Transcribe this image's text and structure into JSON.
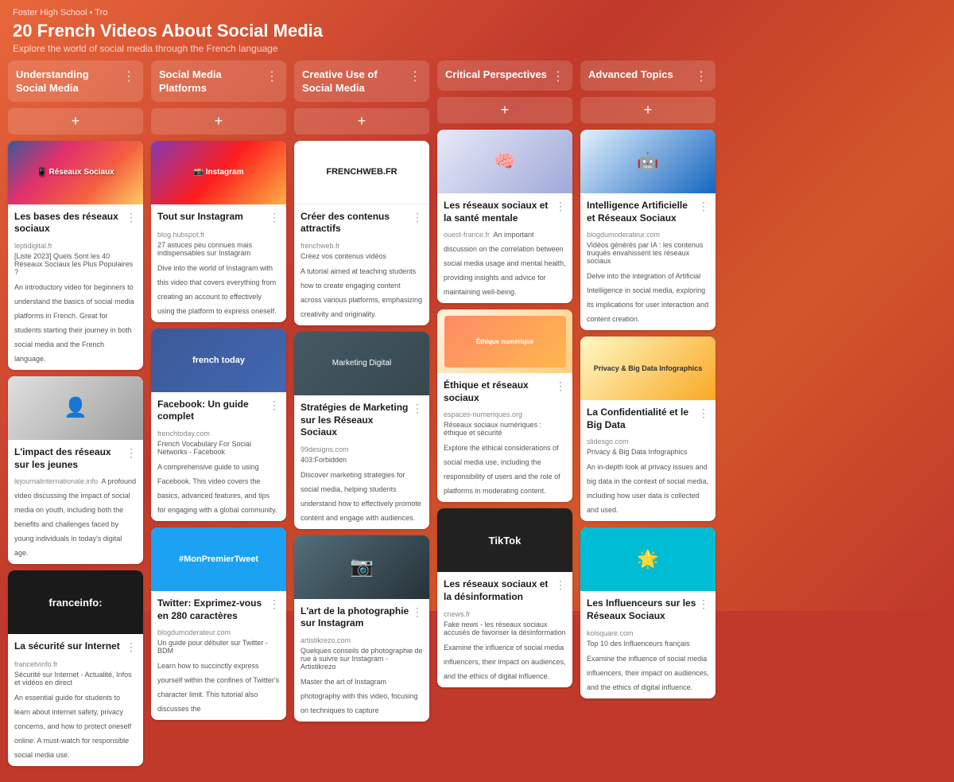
{
  "header": {
    "breadcrumb": "Foster High School • Tro",
    "title": "20 French Videos About Social Media",
    "subtitle": "Explore the world of social media through the French language"
  },
  "columns": [
    {
      "id": "col1",
      "title": "Understanding Social Media",
      "cards": [
        {
          "id": "c1",
          "title": "Les bases des réseaux sociaux",
          "source_domain": "leptidigital.fr",
          "source_link": "[Liste 2023] Quels Sont les 40 Réseaux Sociaux les Plus Populaires ?",
          "desc": "An introductory video for beginners to understand the basics of social media platforms in French. Great for students starting their journey in both social media and the French language.",
          "img_class": "img-social-platforms",
          "img_text": ""
        },
        {
          "id": "c2",
          "title": "L'impact des réseaux sur les jeunes",
          "source_domain": "lejournalinternationale.info",
          "source_link": "",
          "desc": "A profound video discussing the impact of social media on youth, including both the benefits and challenges faced by young individuals in today's digital age.",
          "img_class": "img-youth",
          "img_text": ""
        },
        {
          "id": "c3",
          "title": "La sécurité sur Internet",
          "source_domain": "francetvinfo.fr",
          "source_link": "Sécurité sur Internet - Actualité, Infos et vidéos en direct",
          "desc": "An essential guide for students to learn about internet safety, privacy concerns, and how to protect oneself online. A must-watch for responsible social media use.",
          "img_class": "img-internet-safety",
          "img_text": "franceinfo:"
        }
      ]
    },
    {
      "id": "col2",
      "title": "Social Media Platforms",
      "cards": [
        {
          "id": "c4",
          "title": "Tout sur Instagram",
          "source_domain": "blog.hubspot.fr",
          "source_link": "27 astuces peu connues mais indispensables sur Instagram",
          "desc": "Dive into the world of Instagram with this video that covers everything from creating an account to effectively using the platform to express oneself.",
          "img_class": "img-instagram",
          "img_text": ""
        },
        {
          "id": "c5",
          "title": "Facebook: Un guide complet",
          "source_domain": "frenchtoday.com",
          "source_link": "French Vocabulary For Social Networks - Facebook",
          "desc": "A comprehensive guide to using Facebook. This video covers the basics, advanced features, and tips for engaging with a global community.",
          "img_class": "img-facebook",
          "img_text": "french today"
        },
        {
          "id": "c6",
          "title": "Twitter: Exprimez-vous en 280 caractères",
          "source_domain": "blogdumoderateur.com",
          "source_link": "Un guide pour débuter sur Twitter - BDM",
          "desc": "Learn how to succinctly express yourself within the confines of Twitter's character limit. This tutorial also discusses the",
          "img_class": "img-twitter",
          "img_text": "#MonPremierTweet"
        }
      ]
    },
    {
      "id": "col3",
      "title": "Creative Use of Social Media",
      "cards": [
        {
          "id": "c7",
          "title": "Créer des contenus attractifs",
          "source_domain": "frenchweb.fr",
          "source_link": "Créez vos contenus vidéos",
          "desc": "A tutorial aimed at teaching students how to create engaging content across various platforms, emphasizing creativity and originality.",
          "img_class": "img-creative",
          "img_text": "FRENCHWEB.FR"
        },
        {
          "id": "c8",
          "title": "Stratégies de Marketing sur les Réseaux Sociaux",
          "source_domain": "99designs.com",
          "source_link": "403:Forbidden",
          "desc": "Discover marketing strategies for social media, helping students understand how to effectively promote content and engage with audiences.",
          "img_class": "img-marketing",
          "img_text": ""
        },
        {
          "id": "c9",
          "title": "L'art de la photographie sur Instagram",
          "source_domain": "artistikrezo.com",
          "source_link": "Quelques conseils de photographie de rue à suivre sur Instagram - Artistikrezo",
          "desc": "Master the art of Instagram photography with this video, focusing on techniques to capture",
          "img_class": "img-photography",
          "img_text": ""
        }
      ]
    },
    {
      "id": "col4",
      "title": "Critical Perspectives",
      "cards": [
        {
          "id": "c10",
          "title": "Les réseaux sociaux et la santé mentale",
          "source_domain": "ouest-france.fr",
          "source_link": "",
          "desc": "An important discussion on the correlation between social media usage and mental health, providing insights and advice for maintaining well-being.",
          "img_class": "img-mental-health",
          "img_text": ""
        },
        {
          "id": "c11",
          "title": "Éthique et réseaux sociaux",
          "source_domain": "espaces-numeriques.org",
          "source_link": "Réseaux sociaux numériques : éthique et sécurité",
          "desc": "Explore the ethical considerations of social media use, including the responsibility of users and the role of platforms in moderating content.",
          "img_class": "img-ethics",
          "img_text": ""
        },
        {
          "id": "c12",
          "title": "Les réseaux sociaux et la désinformation",
          "source_domain": "cnews.fr",
          "source_link": "Fake news - les réseaux sociaux accusés de favoriser la désinformation",
          "desc": "Examine the influence of social media influencers, their impact on audiences, and the ethics of digital influence.",
          "img_class": "img-disinformation",
          "img_text": "TikTok"
        }
      ]
    },
    {
      "id": "col5",
      "title": "Advanced Topics",
      "cards": [
        {
          "id": "c13",
          "title": "Intelligence Artificielle et Réseaux Sociaux",
          "source_domain": "blogdumoderateur.com",
          "source_link": "Vidéos générés par IA : les contenus truqués envahissent les réseaux sociaux",
          "desc": "Delve into the integration of Artificial Intelligence in social media, exploring its implications for user interaction and content creation.",
          "img_class": "img-ai",
          "img_text": ""
        },
        {
          "id": "c14",
          "title": "La Confidentialité et le Big Data",
          "source_domain": "slidesgo.com",
          "source_link": "Privacy & Big Data Infographics",
          "desc": "An in-depth look at privacy issues and big data in the context of social media, including how user data is collected and used.",
          "img_class": "img-privacy",
          "img_text": "Privacy & Big Data Infographics"
        },
        {
          "id": "c15",
          "title": "Les Influenceurs sur les Réseaux Sociaux",
          "source_domain": "kolsquare.com",
          "source_link": "Top 10 des Influenceurs français",
          "desc": "Examine the influence of social media influencers, their impact on audiences, and the ethics of digital influence.",
          "img_class": "img-influencers",
          "img_text": ""
        }
      ]
    }
  ],
  "ui": {
    "add_card_label": "+",
    "menu_icon": "⋮",
    "col_add_aria": "Add a card"
  }
}
